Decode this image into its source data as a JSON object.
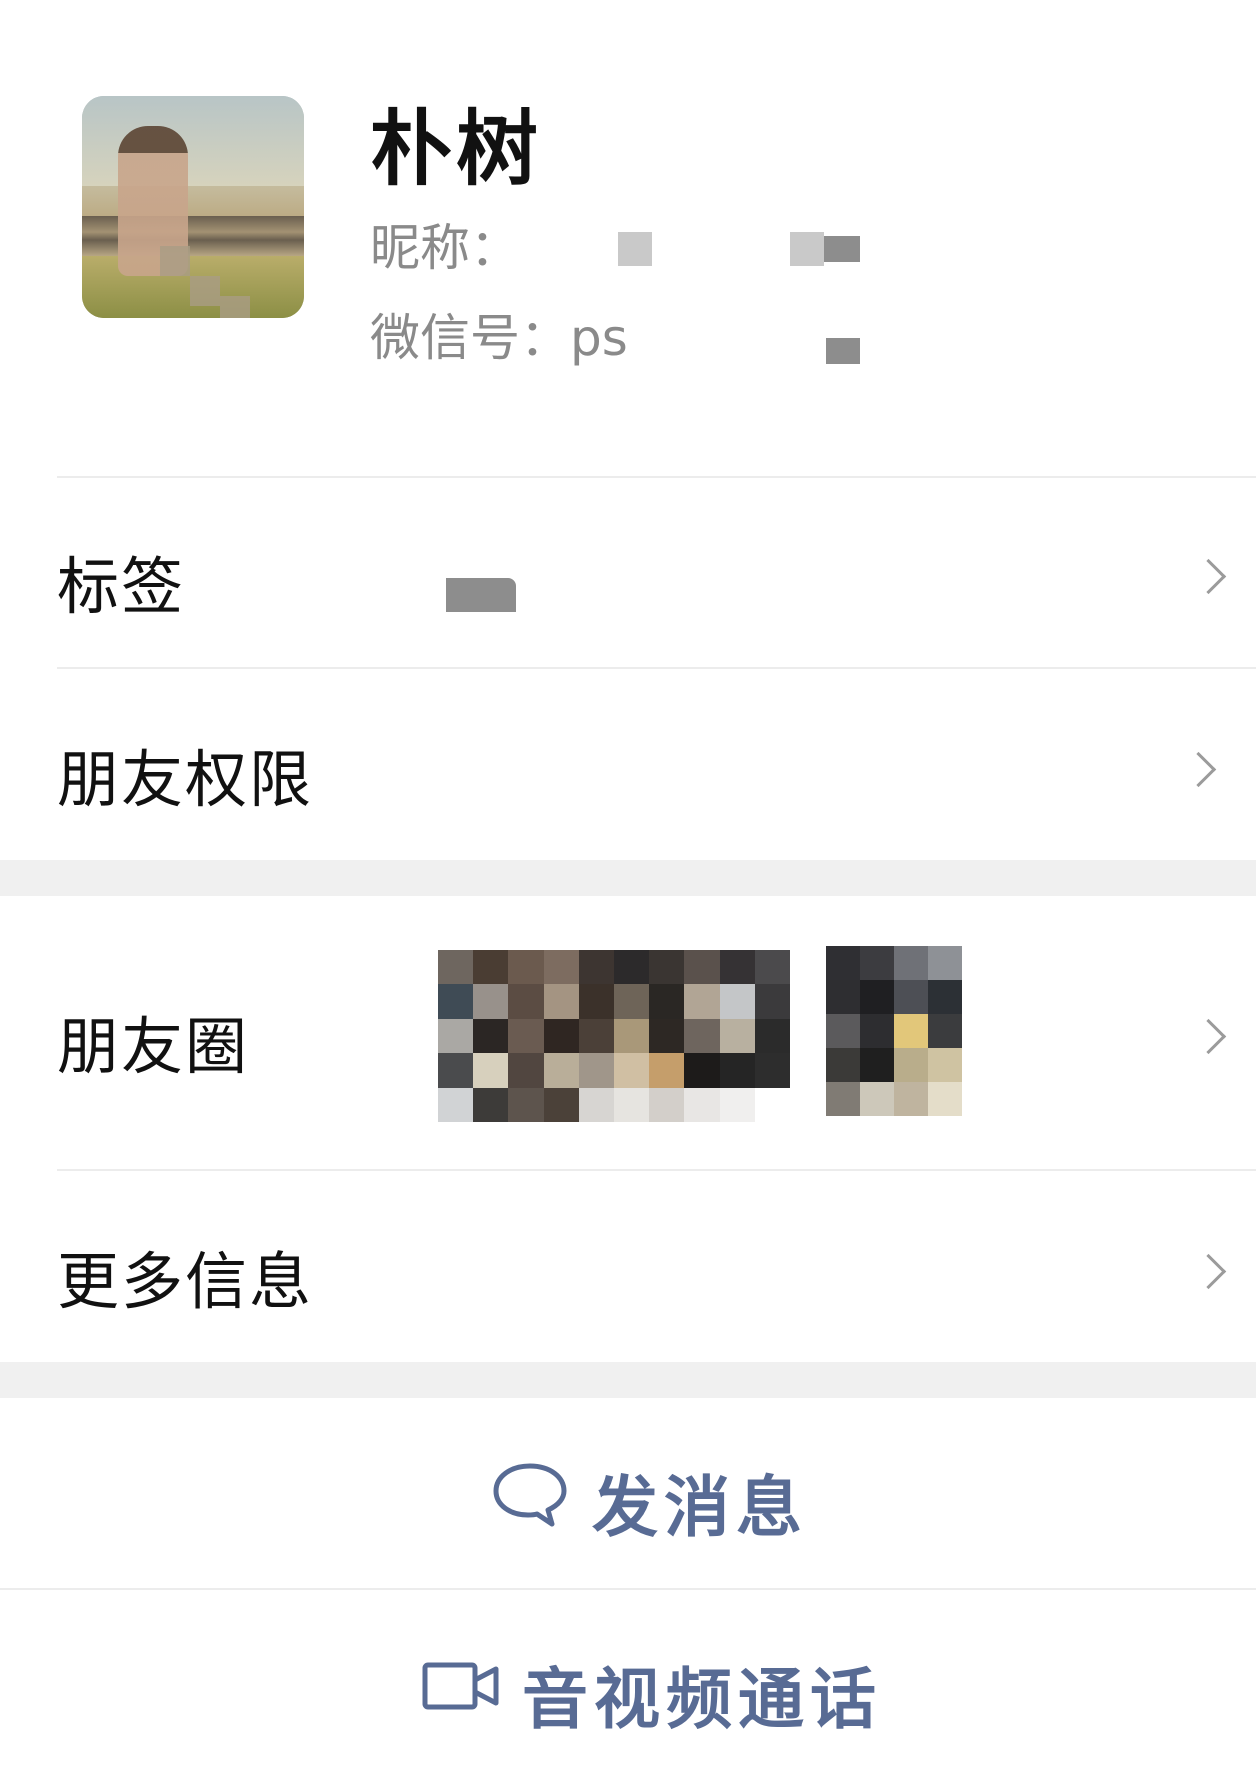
{
  "profile": {
    "display_name": "朴树",
    "nickname_label": "昵称：",
    "wechat_id_label": "微信号：ps"
  },
  "menu": {
    "tags": "标签",
    "friend_permissions": "朋友权限",
    "moments": "朋友圈",
    "more_info": "更多信息"
  },
  "actions": {
    "send_message": "发消息",
    "video_call": "音视频通话"
  },
  "colors": {
    "action_text": "#586b94",
    "separator_band": "#f0f0f0"
  }
}
